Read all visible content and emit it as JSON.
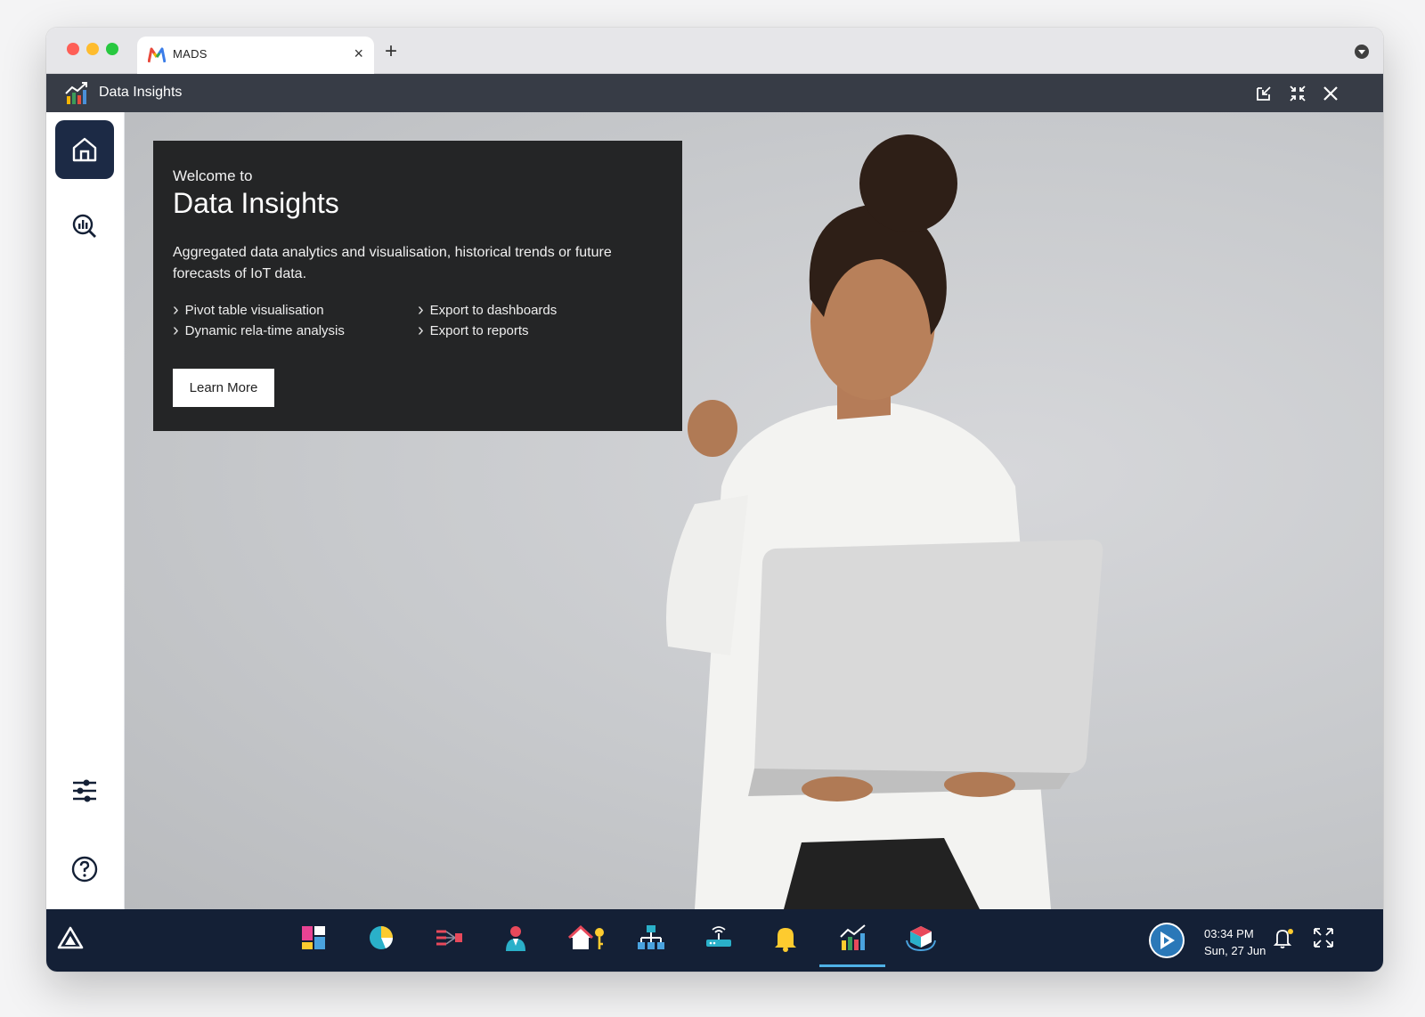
{
  "browser": {
    "tab_title": "MADS",
    "close_glyph": "×",
    "new_tab_glyph": "+"
  },
  "app": {
    "title": "Data Insights"
  },
  "header_actions": [
    "popout-icon",
    "collapse-icon",
    "close-icon"
  ],
  "sidebar": {
    "top": [
      {
        "name": "home-icon",
        "active": true
      },
      {
        "name": "analytics-search-icon",
        "active": false
      }
    ],
    "bottom": [
      {
        "name": "sliders-icon"
      },
      {
        "name": "help-icon"
      }
    ]
  },
  "welcome": {
    "pre_title": "Welcome to",
    "title": "Data Insights",
    "description": "Aggregated data analytics and visualisation, historical trends or future forecasts of IoT data.",
    "features_left": [
      "Pivot table visualisation",
      "Dynamic rela-time analysis"
    ],
    "features_right": [
      "Export to dashboards",
      "Export to reports"
    ],
    "button_label": "Learn More"
  },
  "taskbar": {
    "apps": [
      "dashboard-tiles-icon",
      "pie-chart-icon",
      "data-flow-icon",
      "person-icon",
      "home-key-icon",
      "network-tree-icon",
      "router-icon",
      "bell-alert-icon",
      "data-insights-icon",
      "cube-sync-icon"
    ],
    "active_app": "data-insights-icon",
    "time": "03:34 PM",
    "date": "Sun, 27 Jun"
  },
  "colors": {
    "header": "#373c46",
    "taskbar": "#142036",
    "sidebar_active": "#1c2a45",
    "welcome_panel": "#242526",
    "accent": "#4fb1e6"
  }
}
